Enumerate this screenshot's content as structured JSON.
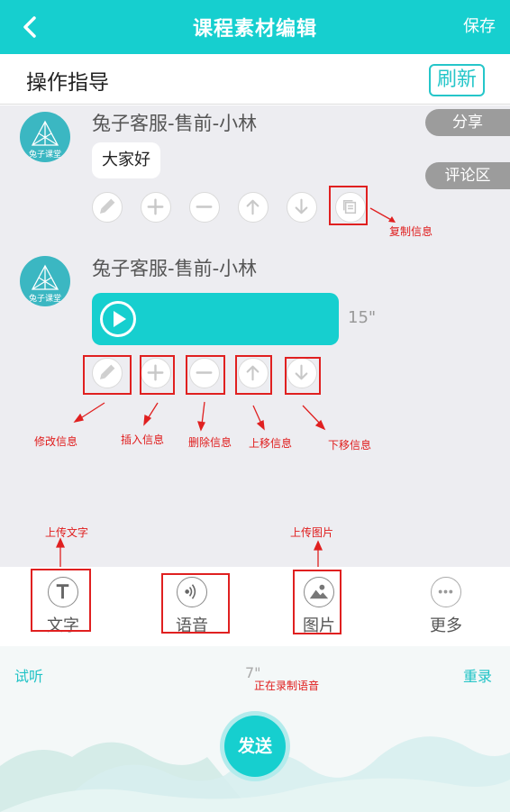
{
  "header": {
    "title": "课程素材编辑",
    "save_label": "保存"
  },
  "guide": {
    "title": "操作指导",
    "refresh_label": "刷新"
  },
  "messages": [
    {
      "sender": "兔子客服-售前-小林",
      "text": "大家好",
      "avatar_text": "兔子课堂"
    },
    {
      "sender": "兔子客服-售前-小林",
      "voice_duration": "15\"",
      "avatar_text": "兔子课堂"
    }
  ],
  "side_tabs": {
    "share": "分享",
    "comments": "评论区"
  },
  "annotations": {
    "copy": "复制信息",
    "edit": "修改信息",
    "insert": "插入信息",
    "delete": "删除信息",
    "move_up": "上移信息",
    "move_down": "下移信息",
    "upload_text": "上传文字",
    "upload_image": "上传图片",
    "recording": "正在录制语音"
  },
  "toolbar": {
    "text": "文字",
    "voice": "语音",
    "image": "图片",
    "more": "更多"
  },
  "recording": {
    "listen": "试听",
    "rerecord": "重录",
    "duration": "7\"",
    "send": "发送"
  },
  "colors": {
    "accent": "#16cfcf",
    "annotation": "#e02020",
    "background": "#ededf1"
  }
}
